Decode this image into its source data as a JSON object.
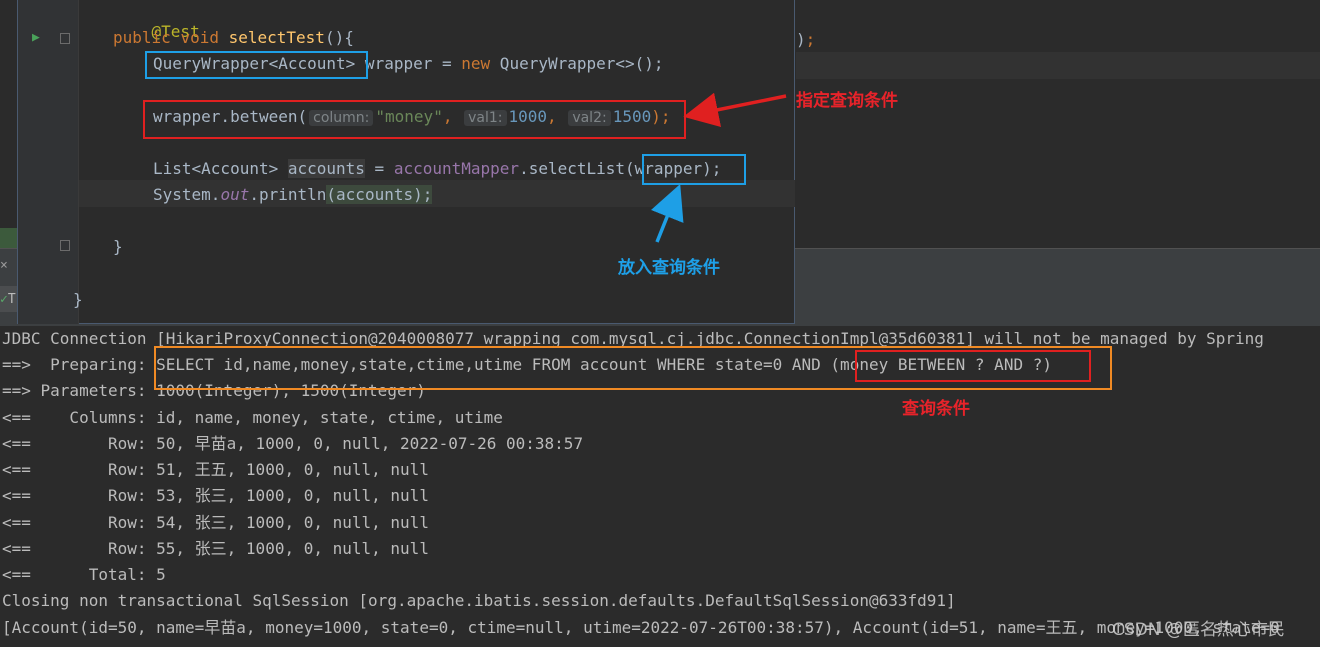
{
  "editor_background": {
    "line_end_fragment_paren": ")",
    "line_end_fragment_semi": ";"
  },
  "run_panel": {
    "close_glyph": "×",
    "tree_item_label": "T"
  },
  "popup_code": {
    "annotation": "@Test",
    "method_keyword_public": "public",
    "method_keyword_void": "void",
    "method_name": "selectTest",
    "method_parens": "(){",
    "line_querywrapper_type": "QueryWrapper<Account>",
    "line_querywrapper_rest_a": " wrapper = ",
    "line_querywrapper_new": "new",
    "line_querywrapper_rest_b": " QueryWrapper<>();",
    "line_between_call": "wrapper.between(",
    "hint_column": "column:",
    "arg_column": "\"money\"",
    "hint_val1": "val1:",
    "arg_val1": "1000",
    "hint_val2": "val2:",
    "arg_val2": "1500",
    "line_between_end": ");",
    "line_list_type": "List<Account> ",
    "line_list_var": "accounts",
    "line_list_eq": " = ",
    "line_list_mapper": "accountMapper",
    "line_list_method": ".selectList",
    "line_list_args": "(wrapper);",
    "line_println_a": "System.",
    "line_println_out": "out",
    "line_println_b": ".println",
    "line_println_c": "(accounts);",
    "close_brace_inner": "}",
    "close_brace_outer": "}",
    "comma": ","
  },
  "console_lines": [
    "JDBC Connection [HikariProxyConnection@2040008077 wrapping com.mysql.cj.jdbc.ConnectionImpl@35d60381] will not be managed by Spring",
    "==>  Preparing: SELECT id,name,money,state,ctime,utime FROM account WHERE state=0 AND (money BETWEEN ? AND ?)",
    "==> Parameters: 1000(Integer), 1500(Integer)",
    "<==    Columns: id, name, money, state, ctime, utime",
    "<==        Row: 50, 早苗a, 1000, 0, null, 2022-07-26 00:38:57",
    "<==        Row: 51, 王五, 1000, 0, null, null",
    "<==        Row: 53, 张三, 1000, 0, null, null",
    "<==        Row: 54, 张三, 1000, 0, null, null",
    "<==        Row: 55, 张三, 1000, 0, null, null",
    "<==      Total: 5",
    "Closing non transactional SqlSession [org.apache.ibatis.session.defaults.DefaultSqlSession@633fd91]",
    "[Account(id=50, name=早苗a, money=1000, state=0, ctime=null, utime=2022-07-26T00:38:57), Account(id=51, name=王五, money=1000, state=0"
  ],
  "annotations": {
    "specify_condition": "指定查询条件",
    "put_condition": "放入查询条件",
    "query_condition": "查询条件"
  },
  "watermark": "CSDN @匿名热心市民",
  "colors": {
    "annotation_red": "#e8232a",
    "annotation_blue": "#1ea0e8",
    "annotation_orange": "#f08a24"
  }
}
